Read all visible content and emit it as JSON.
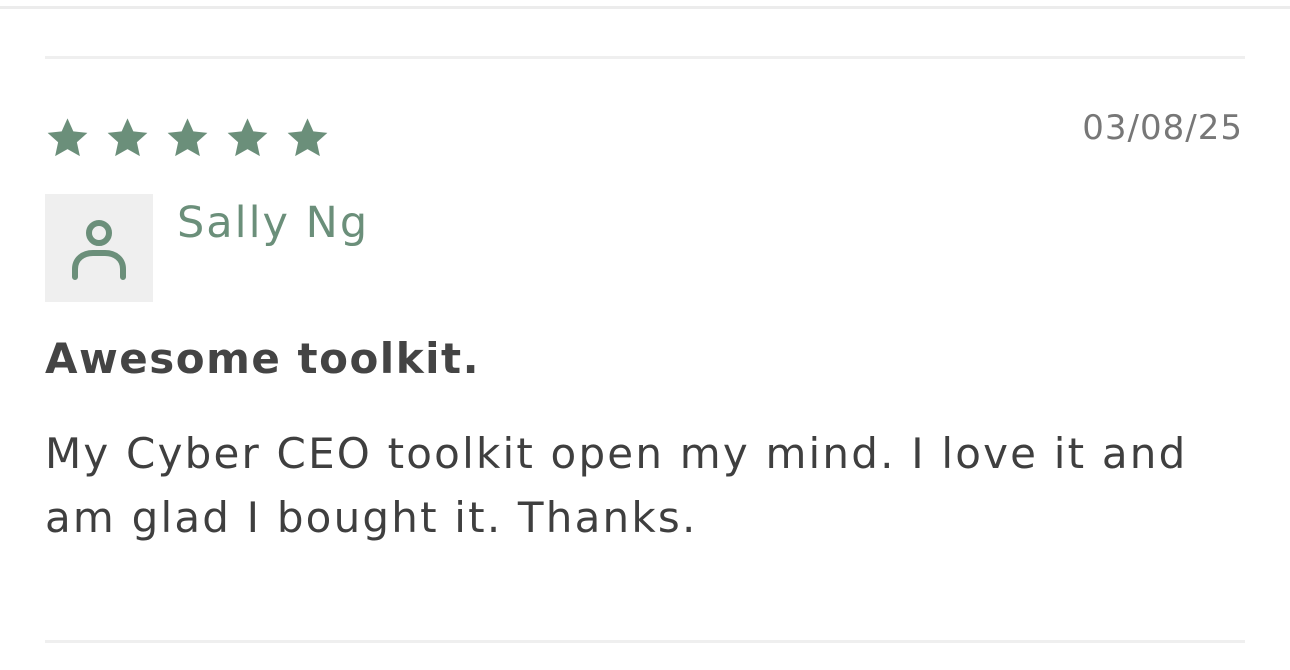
{
  "review": {
    "rating": 5,
    "rating_max": 5,
    "date": "03/08/25",
    "author": "Sally Ng",
    "title": "Awesome toolkit.",
    "body": "My Cyber CEO toolkit open my mind. I love it and am glad I bought it. Thanks."
  },
  "icons": {
    "star": "star-icon",
    "avatar": "user-icon"
  },
  "colors": {
    "accent": "#6b8f7a",
    "text": "#444444",
    "muted": "#777777",
    "divider": "#efefef",
    "avatar_bg": "#efefef"
  }
}
